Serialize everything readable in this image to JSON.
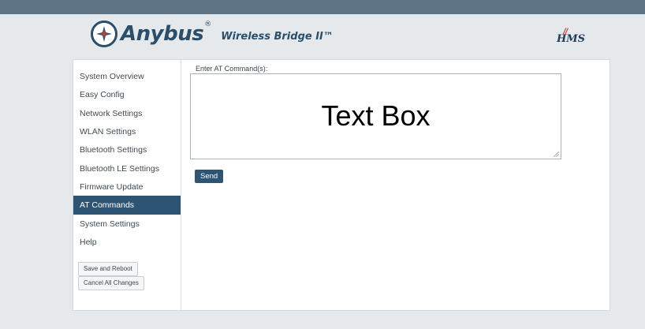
{
  "header": {
    "brand": "Anybus",
    "registered": "®",
    "product": "Wireless Bridge II™",
    "company_logo": "HMS"
  },
  "sidebar": {
    "items": [
      {
        "label": "System Overview",
        "active": false
      },
      {
        "label": "Easy Config",
        "active": false
      },
      {
        "label": "Network Settings",
        "active": false
      },
      {
        "label": "WLAN Settings",
        "active": false
      },
      {
        "label": "Bluetooth Settings",
        "active": false
      },
      {
        "label": "Bluetooth LE Settings",
        "active": false
      },
      {
        "label": "Firmware Update",
        "active": false
      },
      {
        "label": "AT Commands",
        "active": true
      },
      {
        "label": "System Settings",
        "active": false
      },
      {
        "label": "Help",
        "active": false
      }
    ],
    "save_reboot_label": "Save and Reboot",
    "cancel_changes_label": "Cancel All Changes"
  },
  "main": {
    "input_label": "Enter AT Command(s):",
    "textbox_overlay": "Text Box",
    "send_label": "Send"
  },
  "colors": {
    "topbar": "#5e7383",
    "accent": "#2d5472",
    "brand": "#2b4f6b",
    "hms_red": "#c0262d"
  }
}
